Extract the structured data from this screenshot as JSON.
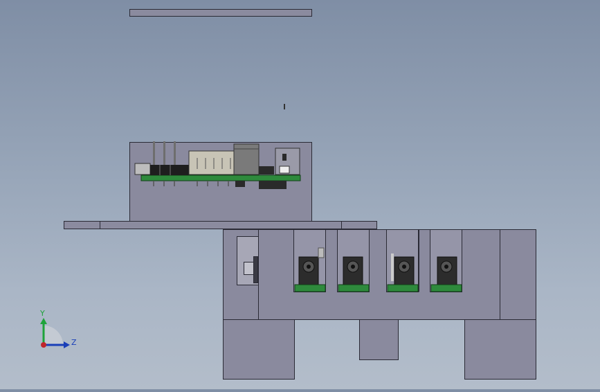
{
  "viewport": {
    "background_top": "#7f8ea5",
    "background_bottom": "#b3bdca",
    "part_fill": "#8a8a9e",
    "part_edge": "#2a2a35",
    "pcb_color": "#2e8a3c",
    "connector_color": "#c8c4b6"
  },
  "triad": {
    "y_label": "Y",
    "z_label": "Z",
    "y_color": "#1fa33a",
    "z_color": "#1a3fb8",
    "x_color": "#c0262c"
  },
  "audio_jacks": {
    "count": 4
  }
}
